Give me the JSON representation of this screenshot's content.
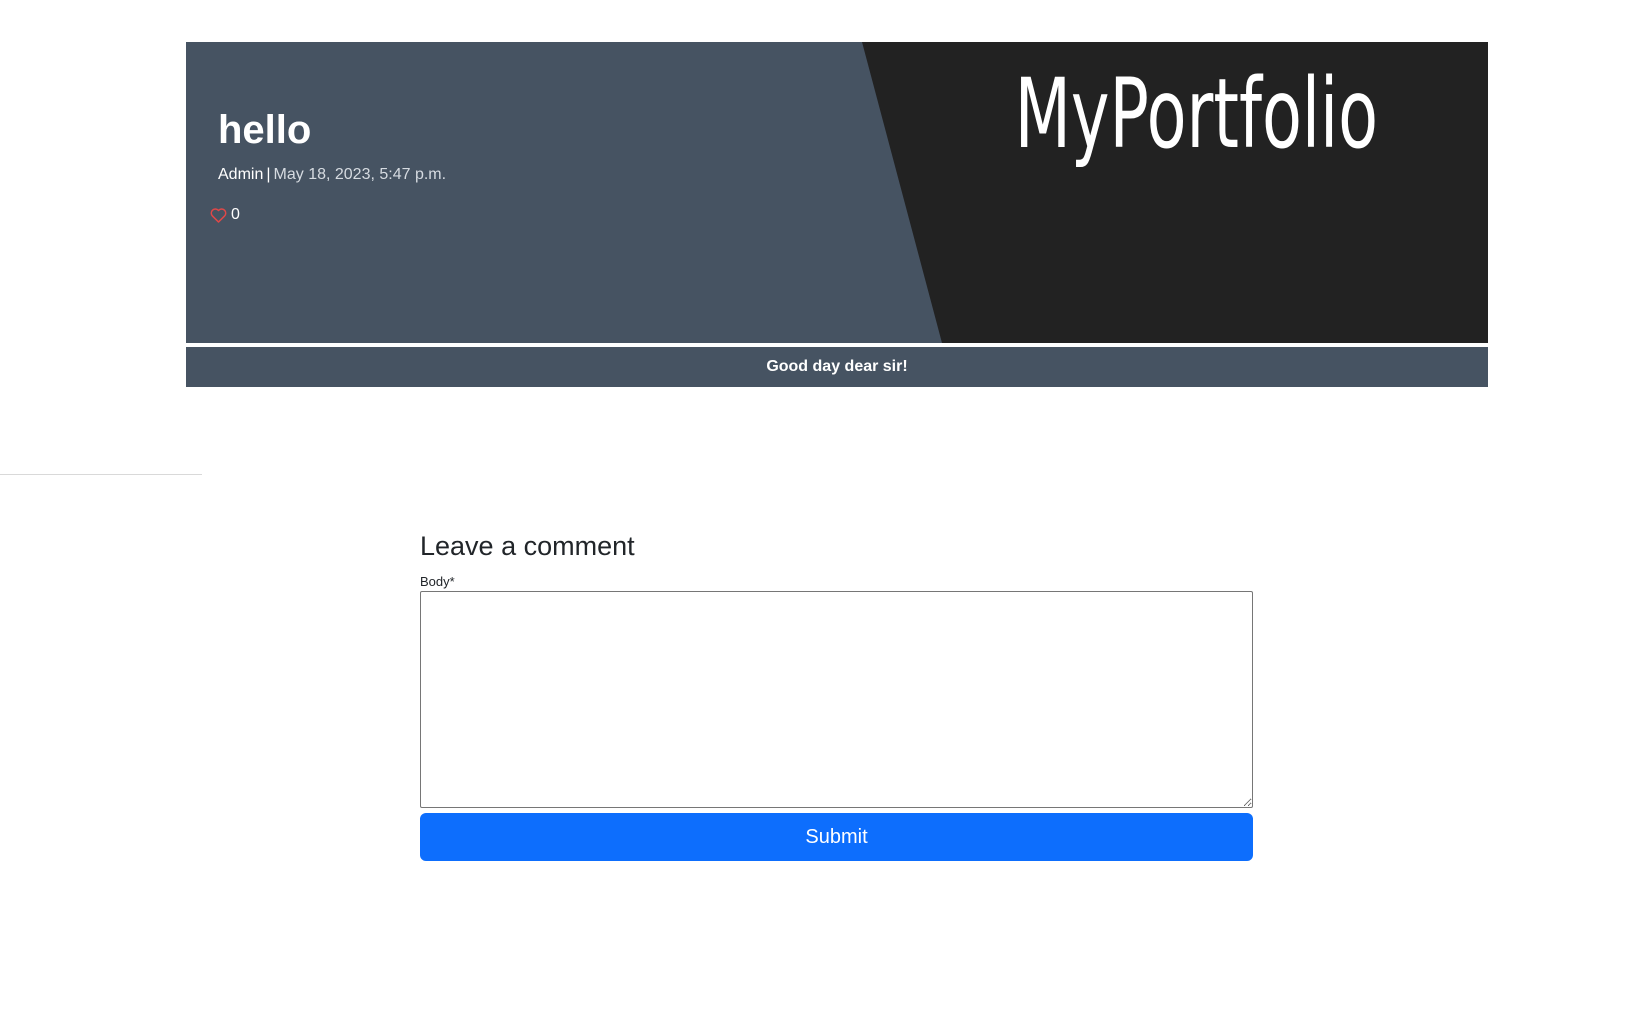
{
  "header": {
    "logo_text": "MyPortfolio"
  },
  "post": {
    "title": "hello",
    "author": "Admin",
    "separator": "|",
    "date": "May 18, 2023, 5:47 p.m.",
    "like_count": "0",
    "body": "Good day dear sir!"
  },
  "comment_form": {
    "heading": "Leave a comment",
    "body_label": "Body*",
    "body_value": "",
    "submit_label": "Submit"
  },
  "colors": {
    "hero_bg": "#465362",
    "hero_dark": "#222222",
    "heart": "#e04848",
    "submit_bg": "#0d6efd"
  },
  "icons": {
    "like": "heart-outline-icon"
  }
}
